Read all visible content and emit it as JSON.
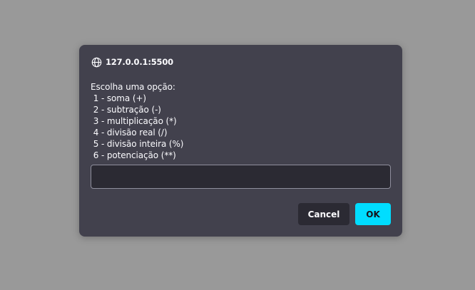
{
  "dialog": {
    "origin": "127.0.0.1:5500",
    "origin_icon": "globe-icon",
    "message": "Escolha uma opção:\n 1 - soma (+)\n 2 - subtração (-)\n 3 - multiplicação (*)\n 4 - divisão real (/)\n 5 - divisão inteira (%)\n 6 - potenciação (**)",
    "input_value": "",
    "cancel_label": "Cancel",
    "ok_label": "OK"
  },
  "colors": {
    "backdrop": "#999999",
    "dialog_bg": "#42414d",
    "input_bg": "#2b2a33",
    "accent": "#00ddff"
  }
}
